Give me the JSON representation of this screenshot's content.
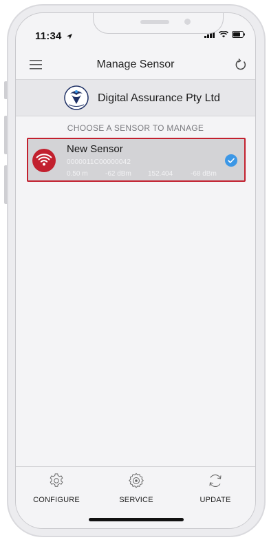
{
  "status_bar": {
    "time": "11:34",
    "location_icon": "location-arrow-icon",
    "signal_icon": "signal-bars-icon",
    "wifi_icon": "wifi-icon",
    "battery_icon": "battery-icon"
  },
  "nav": {
    "title": "Manage Sensor",
    "menu_icon": "hamburger-menu-icon",
    "refresh_icon": "refresh-icon"
  },
  "company": {
    "name": "Digital Assurance Pty Ltd",
    "logo_icon": "company-logo-icon"
  },
  "section_label": "CHOOSE A SENSOR TO MANAGE",
  "sensors": [
    {
      "name": "New Sensor",
      "id": "0000011C00000042",
      "distance": "0.50 m",
      "rssi": "-62 dBm",
      "value": "152.404",
      "rssi2": "-68 dBm",
      "selected": true,
      "icon": "wifi-sensor-icon"
    }
  ],
  "tabs": [
    {
      "label": "CONFIGURE",
      "icon": "gear-outline-icon"
    },
    {
      "label": "SERVICE",
      "icon": "cog-badge-icon"
    },
    {
      "label": "UPDATE",
      "icon": "sync-icon"
    }
  ],
  "colors": {
    "accent_red": "#c2202e",
    "check_blue": "#3c97e6",
    "row_bg": "#d3d3d6"
  }
}
